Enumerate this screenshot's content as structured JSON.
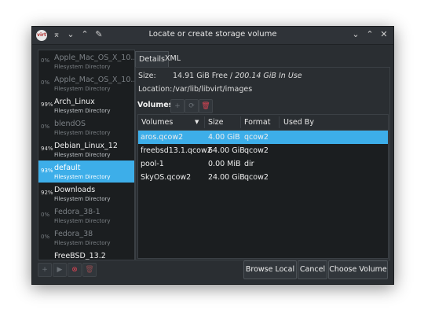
{
  "window": {
    "title": "Locate or create storage volume",
    "app_icon_text": "virt"
  },
  "pools": [
    {
      "pct": "0%",
      "name": "Apple_Mac_OS_X_10....",
      "sub": "Filesystem Directory",
      "active": false
    },
    {
      "pct": "0%",
      "name": "Apple_Mac_OS_X_10....",
      "sub": "Filesystem Directory",
      "active": false
    },
    {
      "pct": "99%",
      "name": "Arch_Linux",
      "sub": "Filesystem Directory",
      "active": true
    },
    {
      "pct": "0%",
      "name": "blendOS",
      "sub": "Filesystem Directory",
      "active": false
    },
    {
      "pct": "94%",
      "name": "Debian_Linux_12",
      "sub": "Filesystem Directory",
      "active": true
    },
    {
      "pct": "93%",
      "name": "default",
      "sub": "Filesystem Directory",
      "active": true,
      "selected": true
    },
    {
      "pct": "92%",
      "name": "Downloads",
      "sub": "Filesystem Directory",
      "active": true
    },
    {
      "pct": "0%",
      "name": "Fedora_38-1",
      "sub": "Filesystem Directory",
      "active": false
    },
    {
      "pct": "0%",
      "name": "Fedora_38",
      "sub": "Filesystem Directory",
      "active": false
    },
    {
      "pct": "",
      "name": "FreeBSD_13.2",
      "sub": "",
      "active": true
    }
  ],
  "tabs": [
    "Details",
    "XML"
  ],
  "details": {
    "size_label": "Size:",
    "size_free": "14.91 GiB Free /",
    "size_in_use": "200.14 GiB In Use",
    "location_label": "Location:",
    "location_value": "/var/lib/libvirt/images",
    "volumes_label": "Volumes"
  },
  "table": {
    "headers": [
      "Volumes",
      "Size",
      "Format",
      "Used By"
    ],
    "rows": [
      [
        "aros.qcow2",
        "4.00 GiB",
        "qcow2",
        ""
      ],
      [
        "freebsd13.1.qcow2",
        "64.00 GiB",
        "qcow2",
        ""
      ],
      [
        "pool-1",
        "0.00 MiB",
        "dir",
        ""
      ],
      [
        "SkyOS.qcow2",
        "24.00 GiB",
        "qcow2",
        ""
      ]
    ]
  },
  "buttons": {
    "browse": "Browse Local",
    "cancel": "Cancel",
    "choose": "Choose Volume"
  },
  "icons": {
    "add": "+",
    "play": "▶",
    "stop": "⊗",
    "delete": "🗑",
    "refresh": "⟳"
  },
  "colors": {
    "selection": "#3daee9",
    "window_bg": "#2a2e32",
    "delete_red": "#da4453"
  }
}
